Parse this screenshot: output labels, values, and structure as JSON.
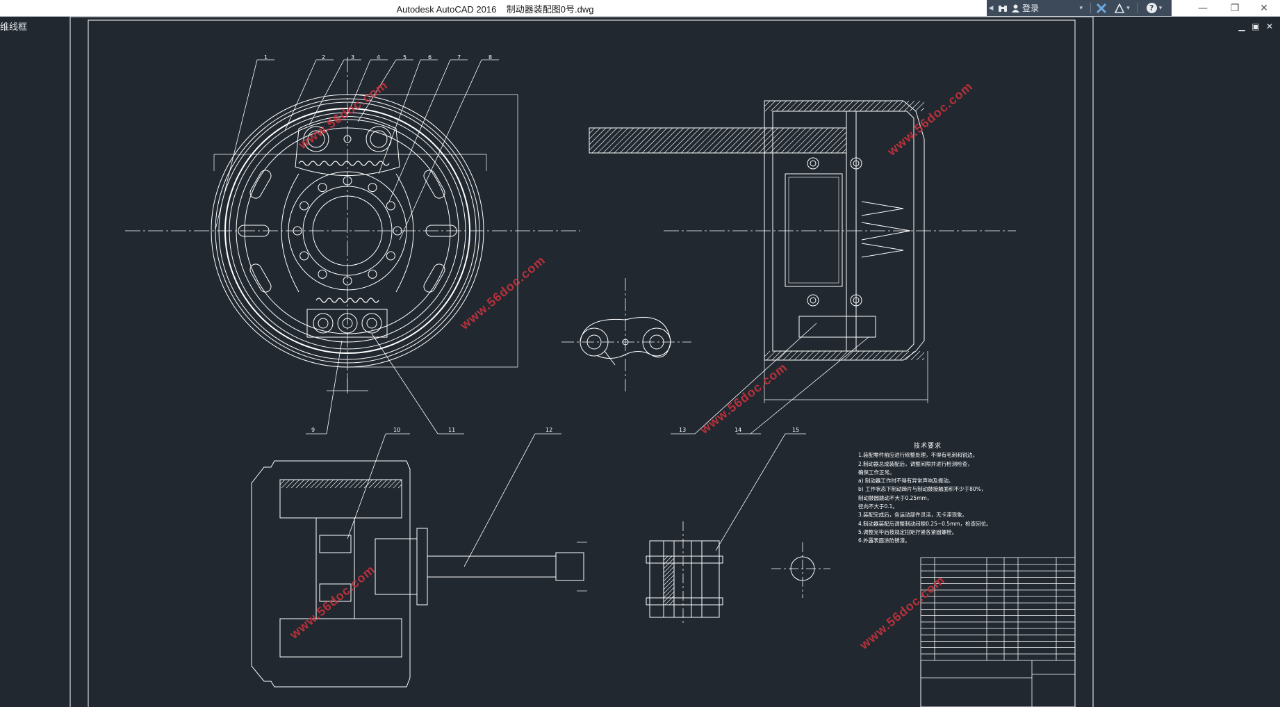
{
  "window": {
    "title": "Autodesk AutoCAD 2016    制动器装配图0号.dwg",
    "infocenter": {
      "login_label": "登录",
      "help_glyph": "?"
    },
    "controls": {
      "minimize": "—",
      "restore": "❐",
      "close": "✕"
    }
  },
  "viewport": {
    "label": "维线框",
    "controls": {
      "minimize": "▁",
      "restore": "▣",
      "close": "✕"
    }
  },
  "watermark_text": "www.56doc.com",
  "balloons": [
    "1",
    "2",
    "3",
    "4",
    "5",
    "6",
    "7",
    "8",
    "9",
    "10",
    "11",
    "12",
    "13",
    "14",
    "15"
  ],
  "technical_notes": {
    "title": "技术要求",
    "lines": [
      "1.装配零件前应进行修整处理，不得有毛刺和锐边。",
      "2.制动器总成装配后，调整间隙并进行检测检查，",
      "   确保工作正常。",
      "a) 制动器工作时不得有异常声响及振动。",
      "b) 工作状态下制动蹄片与制动鼓接触面积不少于80%，",
      "   制动鼓圆跳动不大于0.25mm，",
      "   径向不大于0.1。",
      "3.装配完成后，各运动部件灵活，无卡滞现象。",
      "4.制动器装配后调整制动间隙0.25~0.5mm，检查回位。",
      "5.调整完毕后按规定扭矩拧紧各紧固螺栓。",
      "6.外露表面涂防锈漆。"
    ]
  },
  "colors": {
    "background": "#212830",
    "linework": "#ffffff",
    "watermark": "#c8323c",
    "infocenter": "#3c4a5a"
  }
}
